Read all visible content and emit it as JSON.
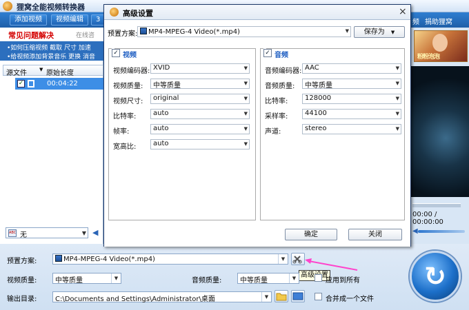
{
  "app": {
    "title": "狸窝全能视频转换器",
    "top_buttons": [
      "添加视频",
      "视频编辑",
      "3"
    ],
    "menu_links": [
      "频",
      "捐助狸窝"
    ]
  },
  "left_panel": {
    "faq_title": "常见问题解决",
    "faq_online": "在线咨",
    "faq_lines": [
      "•如何压缩视频 截取 尺寸 加速",
      "•给视频添加背景音乐 更换 消音"
    ],
    "file_columns": [
      "源文件",
      "原始长度"
    ],
    "file_rows": [
      {
        "checked": true,
        "duration": "00:04:22"
      }
    ],
    "subtitle_value": "无",
    "abc_label": "ABC"
  },
  "right_panel": {
    "ad_text": "粉粉泡泡",
    "timecode": "00:00 / 00:00:00"
  },
  "bottom": {
    "preset_label": "预置方案:",
    "preset_value": "MP4-MPEG-4 Video(*.mp4)",
    "tooltip": "高级设置",
    "video_quality_label": "视频质量:",
    "video_quality_value": "中等质量",
    "audio_quality_label": "音频质量:",
    "audio_quality_value": "中等质量",
    "apply_all_label": "应用到所有",
    "output_label": "输出目录:",
    "output_value": "C:\\Documents and Settings\\Administrator\\桌面",
    "merge_label": "合并成一个文件"
  },
  "dialog": {
    "title": "高级设置",
    "close_glyph": "×",
    "preset_label": "预置方案:",
    "preset_value": "MP4-MPEG-4 Video(*.mp4)",
    "save_as": "保存为",
    "video_group": {
      "title": "视频",
      "checked": true,
      "fields": [
        {
          "label": "视频编码器:",
          "value": "XVID"
        },
        {
          "label": "视频质量:",
          "value": "中等质量"
        },
        {
          "label": "视频尺寸:",
          "value": "original"
        },
        {
          "label": "比特率:",
          "value": "auto"
        },
        {
          "label": "帧率:",
          "value": "auto"
        },
        {
          "label": "宽高比:",
          "value": "auto"
        }
      ]
    },
    "audio_group": {
      "title": "音频",
      "checked": true,
      "fields": [
        {
          "label": "音频编码器:",
          "value": "AAC"
        },
        {
          "label": "音频质量:",
          "value": "中等质量"
        },
        {
          "label": "比特率:",
          "value": "128000"
        },
        {
          "label": "采样率:",
          "value": "44100"
        },
        {
          "label": "声道:",
          "value": "stereo"
        }
      ]
    },
    "ok": "确定",
    "cancel": "关闭"
  }
}
